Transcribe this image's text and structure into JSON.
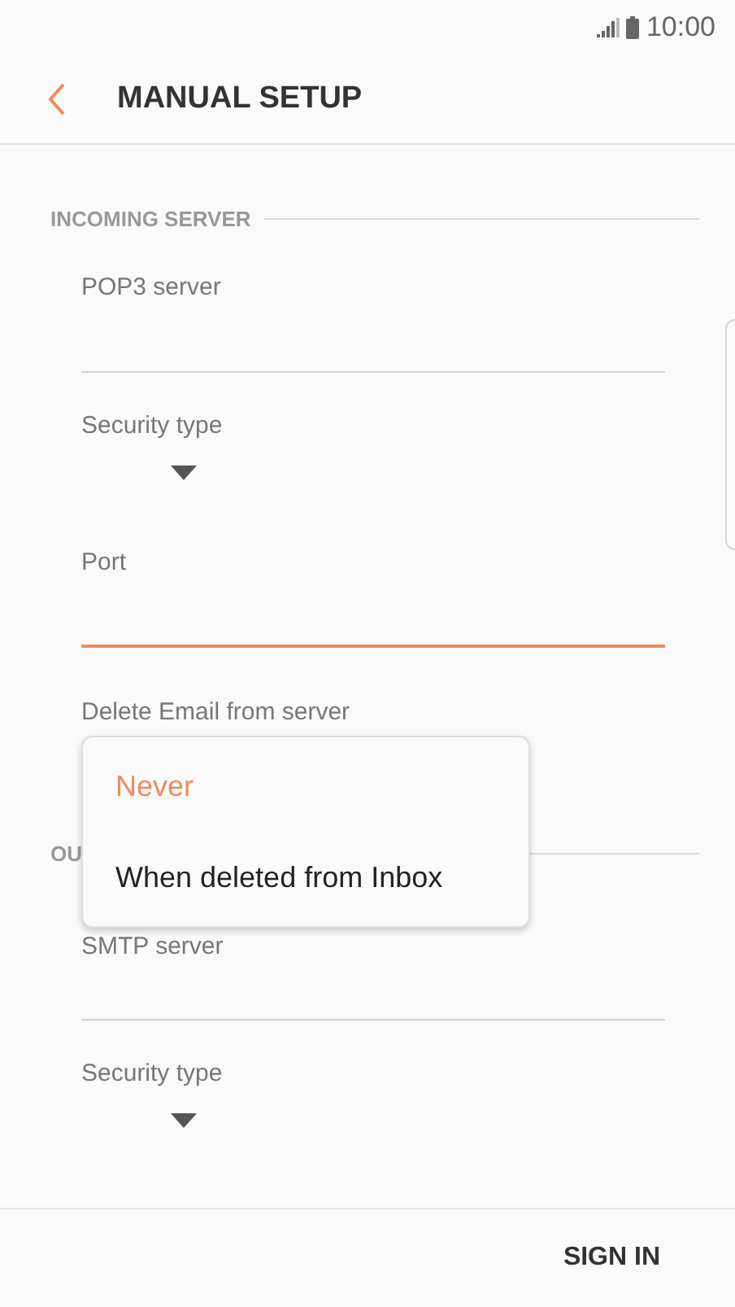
{
  "status_bar": {
    "time": "10:00"
  },
  "app_bar": {
    "title": "MANUAL SETUP"
  },
  "sections": [
    {
      "header": "INCOMING SERVER",
      "fields": [
        {
          "kind": "text",
          "label": "POP3 server",
          "focused": false
        },
        {
          "kind": "dropdown",
          "label": "Security type"
        },
        {
          "kind": "text",
          "label": "Port",
          "focused": true
        },
        {
          "kind": "menu",
          "label": "Delete Email from server",
          "options": [
            {
              "label": "Never",
              "selected": true
            },
            {
              "label": "When deleted from Inbox",
              "selected": false
            }
          ]
        }
      ]
    },
    {
      "header": "OU",
      "fields": [
        {
          "kind": "text",
          "label": "SMTP server",
          "focused": false
        },
        {
          "kind": "dropdown",
          "label": "Security type"
        }
      ]
    }
  ],
  "footer": {
    "button": "SIGN IN"
  }
}
